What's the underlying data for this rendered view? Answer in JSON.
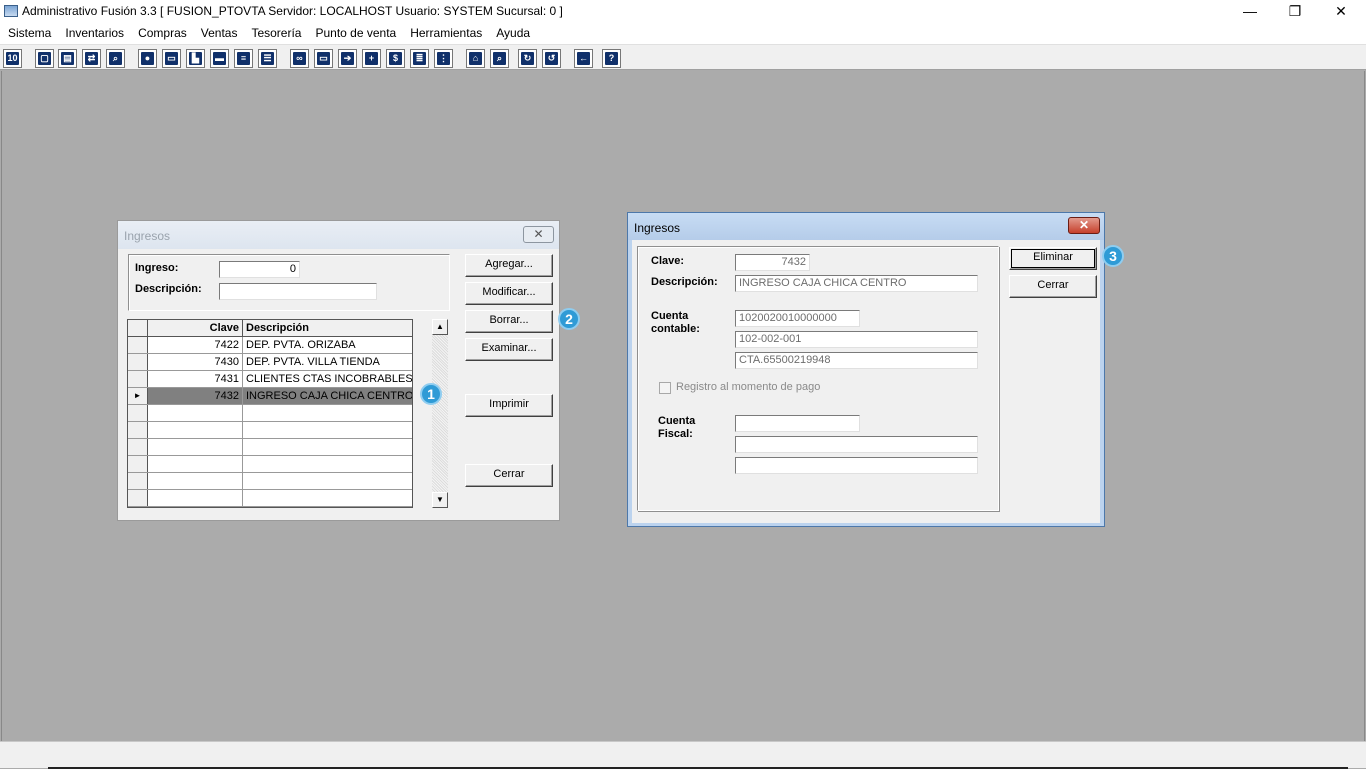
{
  "window": {
    "title": "Administrativo Fusión 3.3 [ FUSION_PTOVTA   Servidor: LOCALHOST   Usuario: SYSTEM    Sucursal: 0 ]",
    "minimize": "—",
    "restore": "❐",
    "close": "✕"
  },
  "menu": [
    "Sistema",
    "Inventarios",
    "Compras",
    "Ventas",
    "Tesorería",
    "Punto de venta",
    "Herramientas",
    "Ayuda"
  ],
  "toolbar": {
    "icons": [
      "calculator-icon",
      "copy-icon",
      "clipboard-icon",
      "transfer-icon",
      "search-doc-icon",
      "user-icon",
      "folder-icon",
      "print-preview-icon",
      "printer-icon",
      "document-icon",
      "list-icon",
      "binoculars-icon",
      "card-icon",
      "export-icon",
      "add-icon",
      "dollar-icon",
      "report-icon",
      "tree-icon",
      "home-icon",
      "zoom-icon",
      "refresh-icon",
      "undo-icon",
      "back-arrow-icon",
      "help-icon"
    ]
  },
  "list_dialog": {
    "title": "Ingresos",
    "close": "✕",
    "ingreso_label": "Ingreso:",
    "ingreso_value": "0",
    "descripcion_label": "Descripción:",
    "descripcion_value": "",
    "columns": [
      "Clave",
      "Descripción"
    ],
    "rows": [
      {
        "clave": "7422",
        "descripcion": "DEP. PVTA. ORIZABA"
      },
      {
        "clave": "7430",
        "descripcion": "DEP. PVTA. VILLA TIENDA"
      },
      {
        "clave": "7431",
        "descripcion": "CLIENTES CTAS INCOBRABLES"
      },
      {
        "clave": "7432",
        "descripcion": "INGRESO CAJA CHICA CENTRO"
      }
    ],
    "selected_row_marker": "►",
    "buttons": {
      "agregar": "Agregar...",
      "modificar": "Modificar...",
      "borrar": "Borrar...",
      "examinar": "Examinar...",
      "imprimir": "Imprimir",
      "cerrar": "Cerrar"
    }
  },
  "detail_dialog": {
    "title": "Ingresos",
    "close": "✕",
    "clave_label": "Clave:",
    "clave_value": "7432",
    "descripcion_label": "Descripción:",
    "descripcion_value": "INGRESO CAJA CHICA CENTRO",
    "cuenta_contable_label": "Cuenta contable:",
    "cuenta_contable_1": "1020020010000000",
    "cuenta_contable_2": "102-002-001",
    "cuenta_contable_3": "CTA.65500219948",
    "registro_label": "Registro al momento de pago",
    "cuenta_fiscal_label": "Cuenta Fiscal:",
    "cuenta_fiscal_1": "",
    "cuenta_fiscal_2": "",
    "cuenta_fiscal_3": "",
    "buttons": {
      "eliminar": "Eliminar",
      "cerrar": "Cerrar"
    }
  },
  "badges": [
    "1",
    "2",
    "3"
  ]
}
